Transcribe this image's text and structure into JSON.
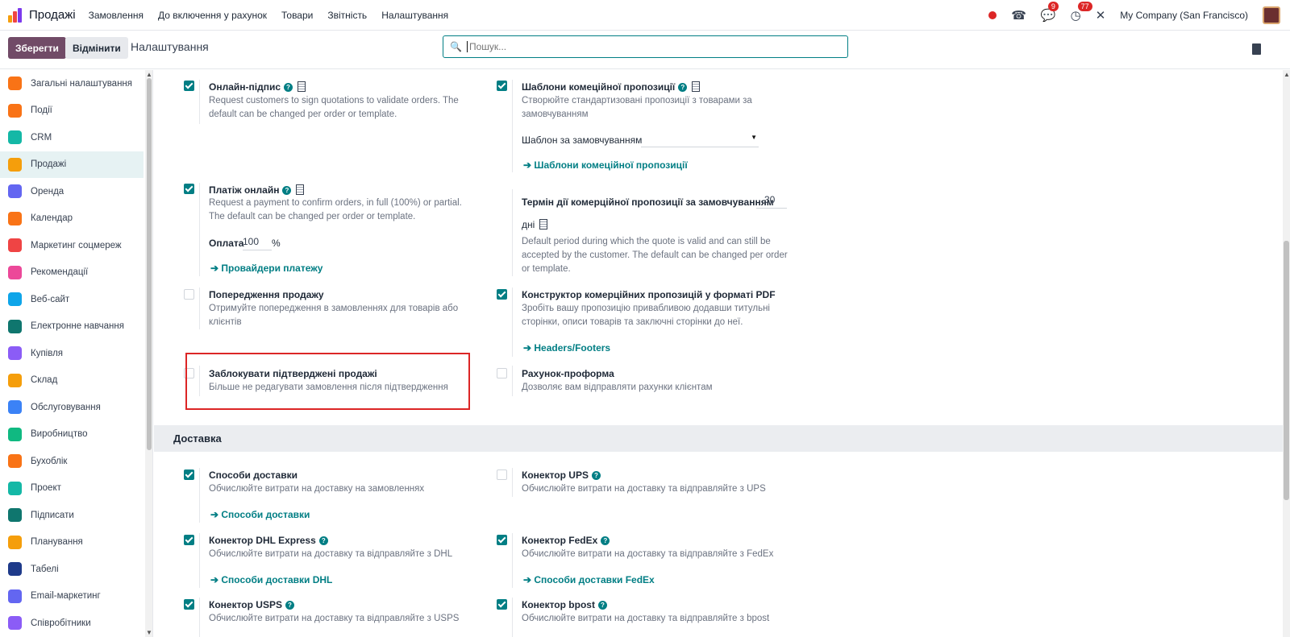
{
  "topbar": {
    "app_name": "Продажі",
    "menu": [
      "Замовлення",
      "До включення у рахунок",
      "Товари",
      "Звітність",
      "Налаштування"
    ],
    "messages_count": "9",
    "activities_count": "77",
    "company": "My Company (San Francisco)"
  },
  "control": {
    "save_label": "Зберегти",
    "discard_label": "Відмінити",
    "breadcrumb": "Налаштування",
    "search_placeholder": "Пошук..."
  },
  "sidebar": {
    "items": [
      {
        "label": "Загальні налаштування",
        "icon": "settings-icon",
        "color": "#f97316"
      },
      {
        "label": "Події",
        "icon": "events-icon",
        "color": "#f97316"
      },
      {
        "label": "CRM",
        "icon": "crm-icon",
        "color": "#14b8a6"
      },
      {
        "label": "Продажі",
        "icon": "sales-icon",
        "color": "#f59e0b"
      },
      {
        "label": "Оренда",
        "icon": "rental-icon",
        "color": "#6366f1"
      },
      {
        "label": "Календар",
        "icon": "calendar-icon",
        "color": "#f97316"
      },
      {
        "label": "Маркетинг соцмереж",
        "icon": "social-marketing-icon",
        "color": "#ef4444"
      },
      {
        "label": "Рекомендації",
        "icon": "referrals-icon",
        "color": "#ec4899"
      },
      {
        "label": "Веб-сайт",
        "icon": "website-icon",
        "color": "#0ea5e9"
      },
      {
        "label": "Електронне навчання",
        "icon": "elearning-icon",
        "color": "#0f766e"
      },
      {
        "label": "Купівля",
        "icon": "purchase-icon",
        "color": "#8b5cf6"
      },
      {
        "label": "Склад",
        "icon": "inventory-icon",
        "color": "#f59e0b"
      },
      {
        "label": "Обслуговування",
        "icon": "maintenance-icon",
        "color": "#3b82f6"
      },
      {
        "label": "Виробництво",
        "icon": "manufacturing-icon",
        "color": "#10b981"
      },
      {
        "label": "Бухоблік",
        "icon": "accounting-icon",
        "color": "#f97316"
      },
      {
        "label": "Проект",
        "icon": "project-icon",
        "color": "#14b8a6"
      },
      {
        "label": "Підписати",
        "icon": "sign-icon",
        "color": "#0f766e"
      },
      {
        "label": "Планування",
        "icon": "planning-icon",
        "color": "#f59e0b"
      },
      {
        "label": "Табелі",
        "icon": "timesheets-icon",
        "color": "#1e3a8a"
      },
      {
        "label": "Email-маркетинг",
        "icon": "email-marketing-icon",
        "color": "#6366f1"
      },
      {
        "label": "Співробітники",
        "icon": "employees-icon",
        "color": "#8b5cf6"
      }
    ],
    "active_index": 3
  },
  "settings": {
    "online_signature": {
      "title": "Онлайн-підпис",
      "checked": true,
      "desc1": "Request customers to sign quotations to validate orders. The",
      "desc2": "default can be changed per order or template."
    },
    "quote_templates": {
      "title": "Шаблони комеційної пропозиції",
      "checked": true,
      "desc1": "Створюйте стандартизовані пропозиції з товарами за",
      "desc2": "замовчуванням",
      "field_label": "Шаблон за замовчуванням",
      "link": "Шаблони комеційної пропозиції"
    },
    "online_payment": {
      "title": "Платіж онлайн",
      "checked": true,
      "desc1": "Request a payment to confirm orders, in full (100%) or partial.",
      "desc2": "The default can be changed per order or template.",
      "field_label": "Оплата",
      "field_value": "100",
      "field_unit": "%",
      "link": "Провайдери платежу"
    },
    "quote_validity": {
      "label": "Термін дії комерційної пропозиції за замовчуванням",
      "value": "30",
      "unit": "дні",
      "desc1": "Default period during which the quote is valid and can still be",
      "desc2": "accepted by the customer. The default can be changed per order",
      "desc3": "or template."
    },
    "sale_warnings": {
      "title": "Попередження продажу",
      "checked": false,
      "desc1": "Отримуйте попередження в замовленнях для товарів або",
      "desc2": "клієнтів"
    },
    "pdf_builder": {
      "title": "Конструктор комерційних пропозицій у форматі PDF",
      "checked": true,
      "desc1": "Зробіть вашу пропозицію привабливою додавши титульні",
      "desc2": "сторінки, описи товарів та заключні сторінки до неї.",
      "link": "Headers/Footers"
    },
    "lock_orders": {
      "title": "Заблокувати підтверджені продажі",
      "checked": false,
      "desc1": "Більше не редагувати замовлення після підтвердження"
    },
    "proforma": {
      "title": "Рахунок-проформа",
      "checked": false,
      "desc1": "Дозволяє вам відправляти рахунки клієнтам"
    }
  },
  "delivery": {
    "heading": "Доставка",
    "methods": {
      "title": "Способи доставки",
      "checked": true,
      "desc1": "Обчислюйте витрати на доставку на замовленнях",
      "link": "Способи доставки"
    },
    "ups": {
      "title": "Конектор UPS",
      "checked": false,
      "desc1": "Обчислюйте витрати на доставку та відправляйте з UPS"
    },
    "dhl": {
      "title": "Конектор DHL Express",
      "checked": true,
      "desc1": "Обчислюйте витрати на доставку та відправляйте з DHL",
      "link": "Способи доставки DHL"
    },
    "fedex": {
      "title": "Конектор FedEx",
      "checked": true,
      "desc1": "Обчислюйте витрати на доставку та відправляйте з FedEx",
      "link": "Способи доставки FedEx"
    },
    "usps": {
      "title": "Конектор USPS",
      "checked": true,
      "desc1": "Обчислюйте витрати на доставку та відправляйте з USPS"
    },
    "bpost": {
      "title": "Конектор bpost",
      "checked": true,
      "desc1": "Обчислюйте витрати на доставку та відправляйте з bpost"
    }
  },
  "colors": {
    "brand": "#714b67",
    "accent": "#017e84",
    "highlight": "#dc2626"
  }
}
